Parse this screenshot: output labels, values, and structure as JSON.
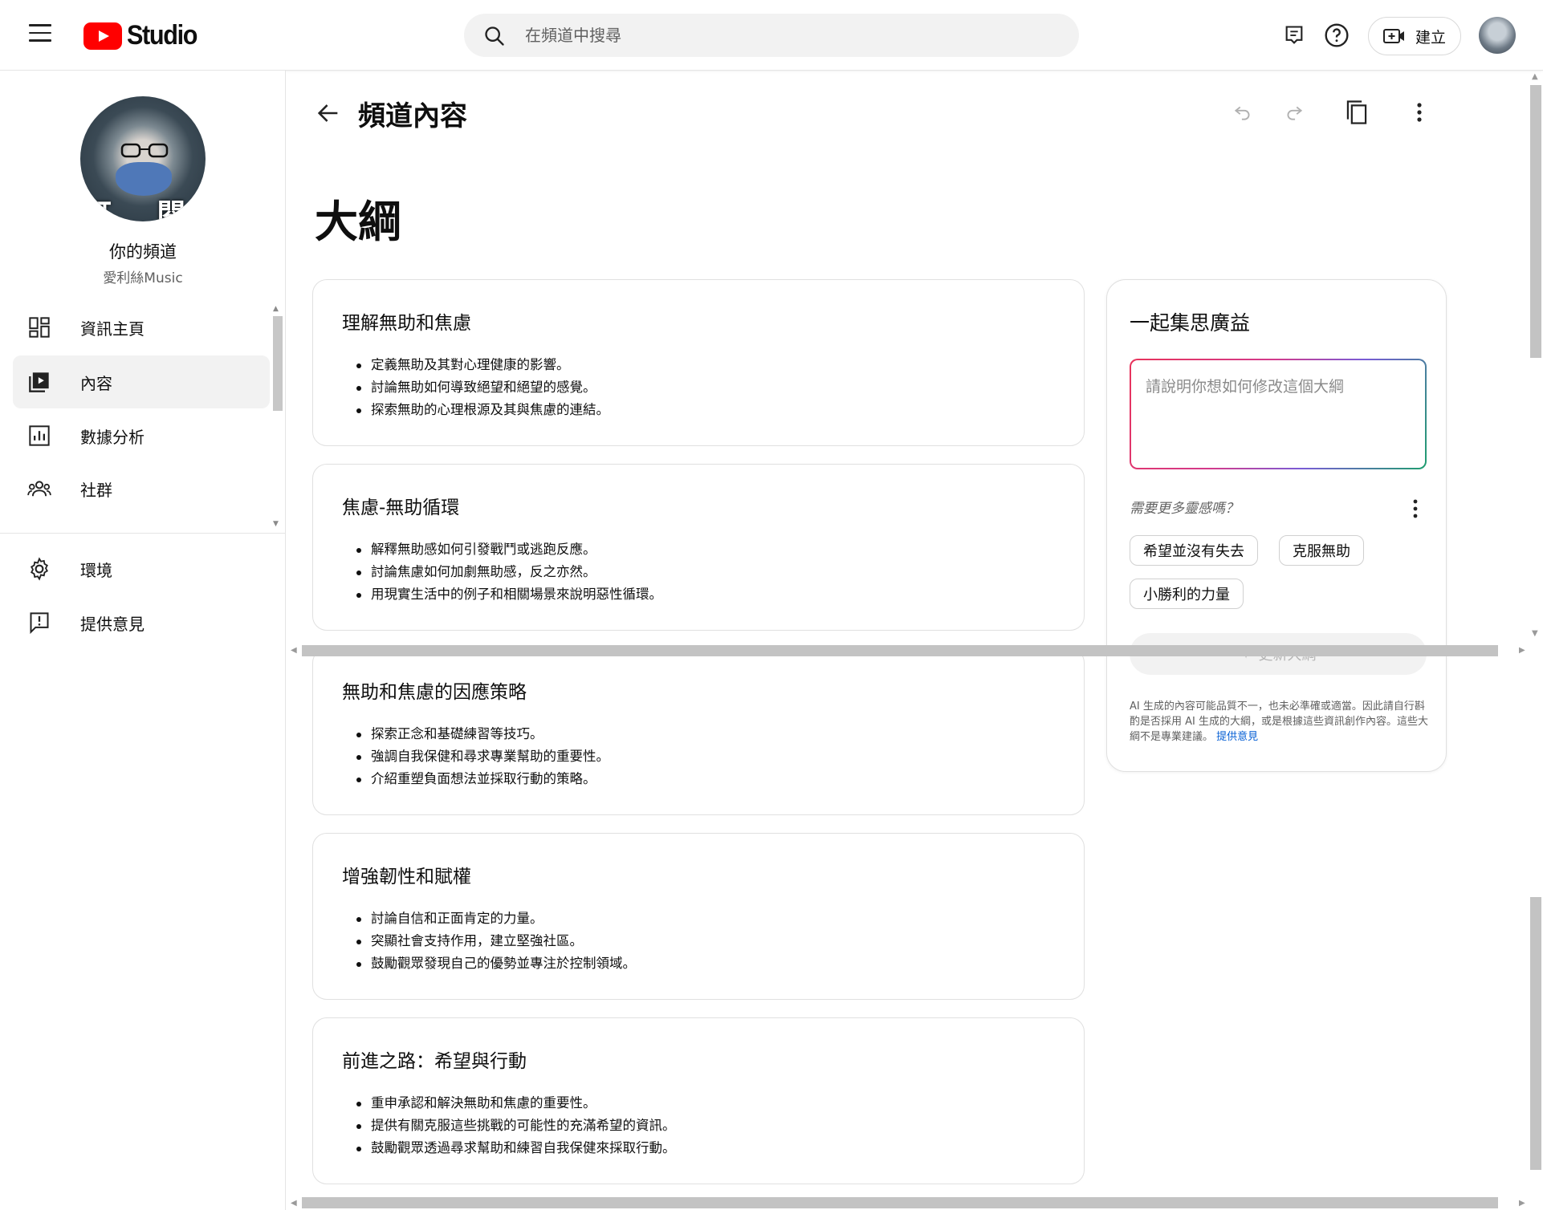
{
  "topbar": {
    "logo_text": "Studio",
    "search_placeholder": "在頻道中搜尋",
    "create_label": "建立"
  },
  "sidebar": {
    "avatar_text": "訂 閱",
    "channel_title": "你的頻道",
    "channel_name": "愛利絲Music",
    "items": [
      {
        "label": "資訊主頁",
        "icon": "dashboard-icon"
      },
      {
        "label": "內容",
        "icon": "content-icon",
        "active": true
      },
      {
        "label": "數據分析",
        "icon": "analytics-icon"
      },
      {
        "label": "社群",
        "icon": "community-icon"
      }
    ],
    "bottom_items": [
      {
        "label": "環境",
        "icon": "settings-gear-icon"
      },
      {
        "label": "提供意見",
        "icon": "feedback-icon"
      }
    ]
  },
  "main": {
    "page_title": "頻道內容",
    "outline_title": "大綱",
    "sections": [
      {
        "title": "理解無助和焦慮",
        "points": [
          "定義無助及其對心理健康的影響。",
          "討論無助如何導致絕望和絕望的感覺。",
          "探索無助的心理根源及其與焦慮的連結。"
        ]
      },
      {
        "title": "焦慮-無助循環",
        "points": [
          "解釋無助感如何引發戰鬥或逃跑反應。",
          "討論焦慮如何加劇無助感，反之亦然。",
          "用現實生活中的例子和相關場景來說明惡性循環。"
        ]
      },
      {
        "title": "無助和焦慮的因應策略",
        "points": [
          "探索正念和基礎練習等技巧。",
          "強調自我保健和尋求專業幫助的重要性。",
          "介紹重塑負面想法並採取行動的策略。"
        ]
      },
      {
        "title": "增強韌性和賦權",
        "points": [
          "討論自信和正面肯定的力量。",
          "突顯社會支持作用，建立堅強社區。",
          "鼓勵觀眾發現自己的優勢並專注於控制領域。"
        ]
      },
      {
        "title": "前進之路：希望與行動",
        "points": [
          "重申承認和解決無助和焦慮的重要性。",
          "提供有關克服這些挑戰的可能性的充滿希望的資訊。",
          "鼓勵觀眾透過尋求幫助和練習自我保健來採取行動。"
        ]
      }
    ]
  },
  "panel": {
    "title": "一起集思廣益",
    "prompt_placeholder": "請說明你想如何修改這個大綱",
    "inspiration_label": "需要更多靈感嗎？",
    "chips": [
      "希望並沒有失去",
      "克服無助",
      "小勝利的力量"
    ],
    "update_button": "更新大綱",
    "disclaimer": "AI 生成的內容可能品質不一，也未必準確或適當。因此請自行斟酌是否採用 AI 生成的大綱，或是根據這些資訊創作內容。這些大綱不是專業建議。",
    "feedback_link": "提供意見"
  },
  "colors": {
    "brand_red": "#ff0000",
    "link_blue": "#065fd4",
    "active_bg": "#f2f2f2"
  }
}
